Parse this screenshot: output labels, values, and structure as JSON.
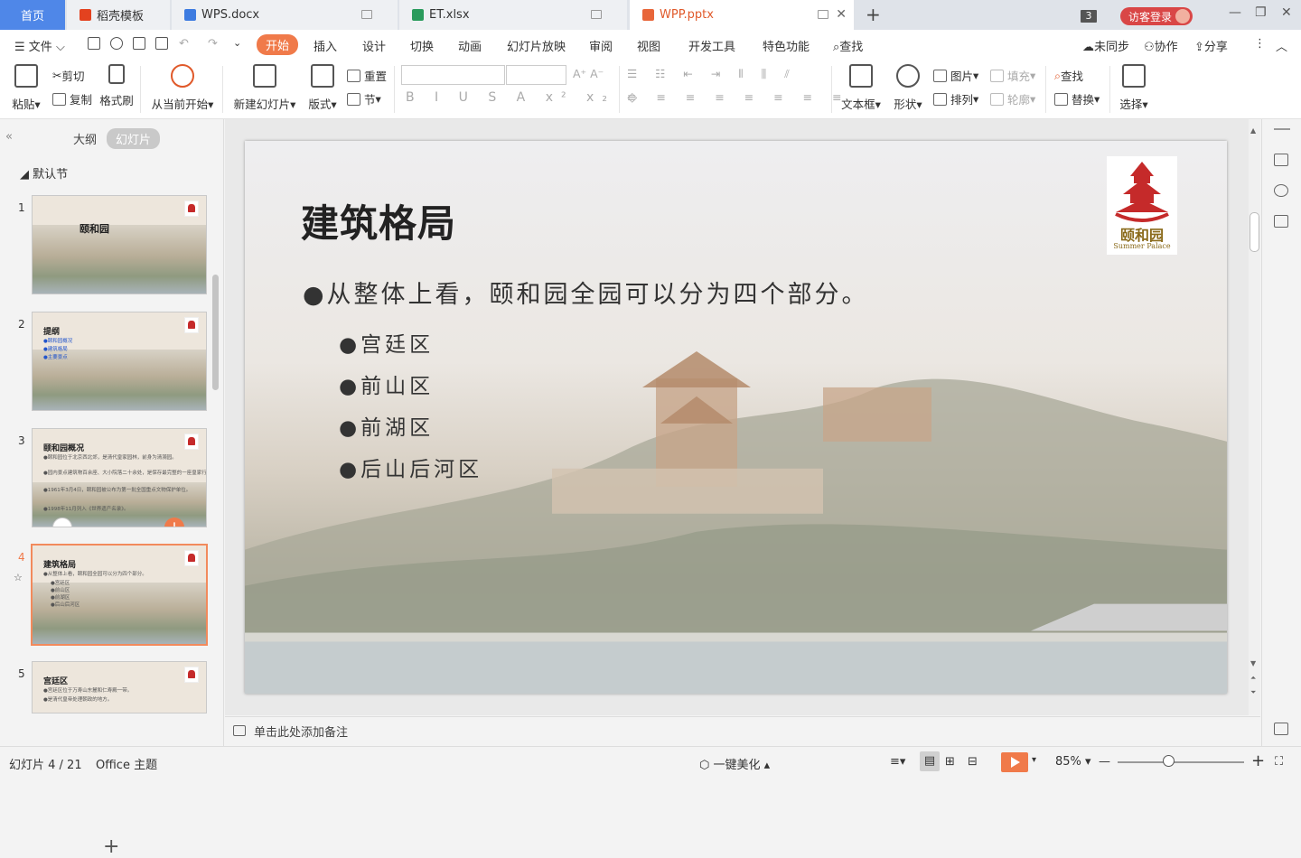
{
  "tabs": {
    "home": "首页",
    "t1": "稻壳模板",
    "t2": "WPS.docx",
    "t3": "ET.xlsx",
    "t4": "WPP.pptx",
    "count": "3",
    "login": "访客登录"
  },
  "menu": {
    "file": "文件",
    "items": [
      "开始",
      "插入",
      "设计",
      "切换",
      "动画",
      "幻灯片放映",
      "审阅",
      "视图",
      "开发工具",
      "特色功能"
    ],
    "search": "查找",
    "sync": "未同步",
    "collab": "协作",
    "share": "分享"
  },
  "ribbon": {
    "paste": "粘贴",
    "cut": "剪切",
    "copy": "复制",
    "format_painter": "格式刷",
    "from_current": "从当前开始",
    "new_slide": "新建幻灯片",
    "layout": "版式",
    "reset": "重置",
    "section": "节",
    "textbox": "文本框",
    "shape": "形状",
    "picture": "图片",
    "fill": "填充",
    "arrange": "排列",
    "outline": "轮廓",
    "find": "查找",
    "replace": "替换",
    "select": "选择"
  },
  "leftpane": {
    "outline": "大纲",
    "slides": "幻灯片",
    "section": "默认节"
  },
  "thumbs": [
    {
      "num": "1",
      "title": "颐和园",
      "lines": []
    },
    {
      "num": "2",
      "title": "提纲",
      "lines": [
        "●颐和园概况",
        "●建筑格局",
        "●主要景点"
      ]
    },
    {
      "num": "3",
      "title": "颐和园概况",
      "lines": [
        "●颐和园位于北京西北郊，是清代皇家园林，前身为清漪园。",
        "●园内景点建筑物百余座、大小院落二十余处，是保存最完整的一座皇家行宫御苑。",
        "●1961年3月4日，颐和园被公布为第一批全国重点文物保护单位。",
        "●1998年11月列入《世界遗产名录》。"
      ]
    },
    {
      "num": "4",
      "title": "建筑格局",
      "lines": [
        "●从整体上看，颐和园全园可以分为四个部分。",
        "●宫廷区",
        "●前山区",
        "●前湖区",
        "●后山后河区"
      ]
    },
    {
      "num": "5",
      "title": "宫廷区",
      "lines": [
        "●宫廷区位于万寿山东麓和仁寿殿一带。",
        "●是清代皇帝处理朝政的地方。"
      ]
    }
  ],
  "slide": {
    "title": "建筑格局",
    "bullet": "●从整体上看，颐和园全园可以分为四个部分。",
    "subs": [
      "●宫廷区",
      "●前山区",
      "●前湖区",
      "●后山后河区"
    ],
    "logo_text": "颐和园",
    "logo_sub": "Summer Palace"
  },
  "notes": "单击此处添加备注",
  "status": {
    "slide_count": "幻灯片 4 / 21",
    "theme": "Office 主题",
    "beautify": "一键美化",
    "zoom": "85%"
  }
}
